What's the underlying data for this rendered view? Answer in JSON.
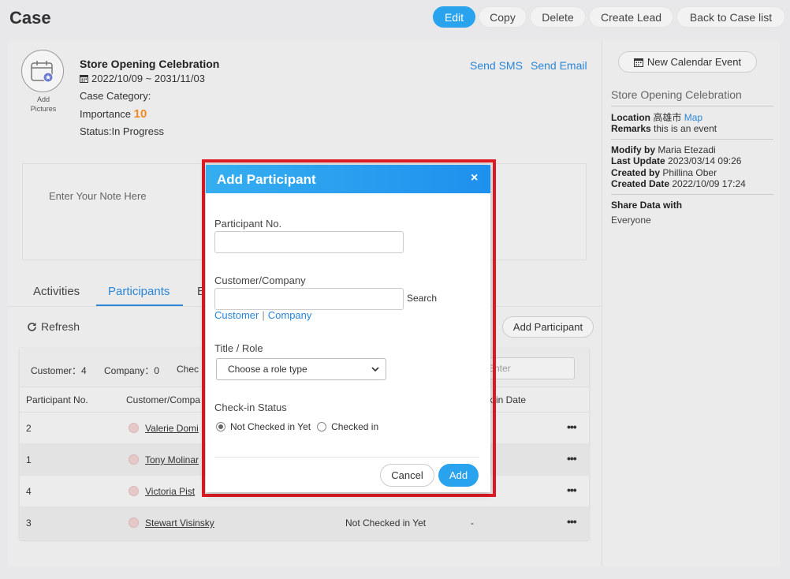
{
  "header": {
    "title": "Case",
    "buttons": {
      "edit": "Edit",
      "copy": "Copy",
      "delete": "Delete",
      "create_lead": "Create Lead",
      "back": "Back to Case list"
    }
  },
  "case": {
    "add_pictures": "Add Pictures",
    "name": "Store Opening Celebration",
    "dates": "2022/10/09 ~ 2031/11/03",
    "category": "Case Category:",
    "importance_label": "Importance",
    "importance_value": "10",
    "status": "Status:In Progress",
    "send_sms": "Send SMS",
    "send_email": "Send Email",
    "note_placeholder": "Enter Your Note Here"
  },
  "tabs": [
    {
      "label": "Activities"
    },
    {
      "label": "Participants"
    },
    {
      "label": "E"
    }
  ],
  "participants": {
    "refresh": "Refresh",
    "add_participant": "Add Participant",
    "summary": {
      "customer": "Customer：4",
      "company": "Company：0",
      "check": "Chec"
    },
    "filter_placeholder": "Enter",
    "columns": {
      "no": "Participant No.",
      "customer": "Customer/Compa",
      "checkin_date": "k-in Date"
    },
    "rows": [
      {
        "no": "2",
        "name": "Valerie Domi",
        "status": "",
        "date": ""
      },
      {
        "no": "1",
        "name": "Tony Molinar",
        "status": "",
        "date": ""
      },
      {
        "no": "4",
        "name": "Victoria Pist",
        "status": "",
        "date": ""
      },
      {
        "no": "3",
        "name": "Stewart Visinsky",
        "status": "Not Checked in Yet",
        "date": "-"
      }
    ]
  },
  "right_panel": {
    "new_event": "New Calendar Event",
    "title": "Store Opening Celebration",
    "location_label": "Location",
    "location_value": "高雄市",
    "map_link": "Map",
    "remarks_label": "Remarks",
    "remarks_value": "this is an event",
    "modify_label": "Modify by",
    "modify_value": "Maria Etezadi",
    "last_update_label": "Last Update",
    "last_update_value": "2023/03/14 09:26",
    "created_by_label": "Created by",
    "created_by_value": "Phillina Ober",
    "created_date_label": "Created Date",
    "created_date_value": "2022/10/09 17:24",
    "share_label": "Share Data with",
    "share_value": "Everyone"
  },
  "dialog": {
    "title": "Add Participant",
    "close": "×",
    "participant_no_label": "Participant No.",
    "participant_no_value": "",
    "customer_company_label": "Customer/Company",
    "customer_company_value": "",
    "search": "Search",
    "customer_link": "Customer",
    "separator": "|",
    "company_link": "Company",
    "title_role_label": "Title / Role",
    "role_select": "Choose a role type",
    "checkin_label": "Check-in Status",
    "radio_not_checked": "Not Checked in Yet",
    "radio_checked": "Checked in",
    "cancel": "Cancel",
    "add": "Add"
  },
  "colors": {
    "accent": "#2aa3ee",
    "link": "#2a86d6",
    "highlight_frame": "#e01b24",
    "importance": "#f08a24"
  }
}
